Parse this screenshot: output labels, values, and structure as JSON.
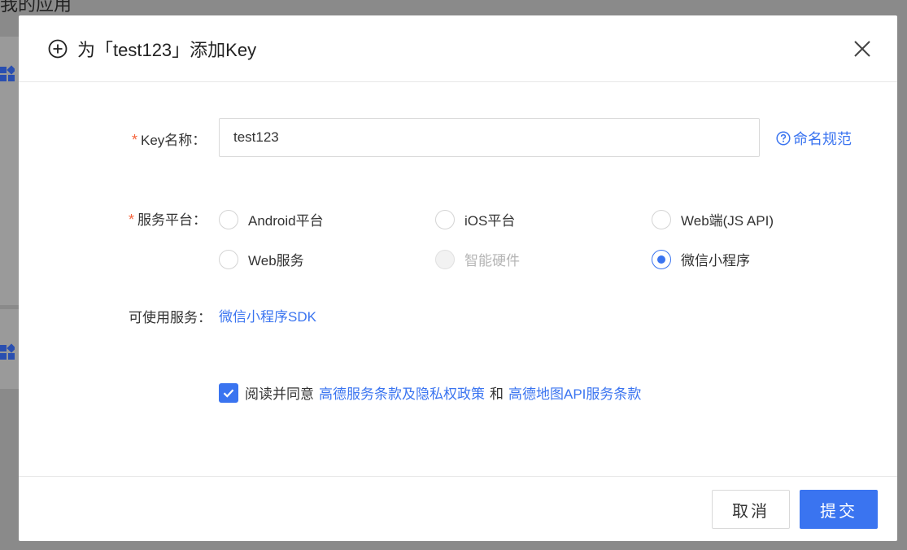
{
  "background": {
    "title_fragment": "我的应用"
  },
  "modal": {
    "title": "为「test123」添加Key",
    "header_icon": "plus-circle-icon",
    "close_icon": "close-icon"
  },
  "form": {
    "key_name": {
      "required_mark": "*",
      "label": "Key名称：",
      "value": "test123",
      "help_link": "命名规范",
      "help_icon": "question-circle-icon"
    },
    "platform": {
      "required_mark": "*",
      "label": "服务平台：",
      "options": [
        {
          "label": "Android平台",
          "checked": false,
          "disabled": false
        },
        {
          "label": "iOS平台",
          "checked": false,
          "disabled": false
        },
        {
          "label": "Web端(JS API)",
          "checked": false,
          "disabled": false
        },
        {
          "label": "Web服务",
          "checked": false,
          "disabled": false
        },
        {
          "label": "智能硬件",
          "checked": false,
          "disabled": true
        },
        {
          "label": "微信小程序",
          "checked": true,
          "disabled": false
        }
      ]
    },
    "available_service": {
      "label": "可使用服务：",
      "value": "微信小程序SDK"
    },
    "agreement": {
      "checked": true,
      "prefix": "阅读并同意",
      "link1": "高德服务条款及隐私权政策",
      "joiner": "和",
      "link2": "高德地图API服务条款"
    }
  },
  "footer": {
    "cancel_label": "取消",
    "submit_label": "提交"
  },
  "colors": {
    "accent": "#3a74f0",
    "required": "#f5643c",
    "overlay": "#8a8a8a"
  }
}
